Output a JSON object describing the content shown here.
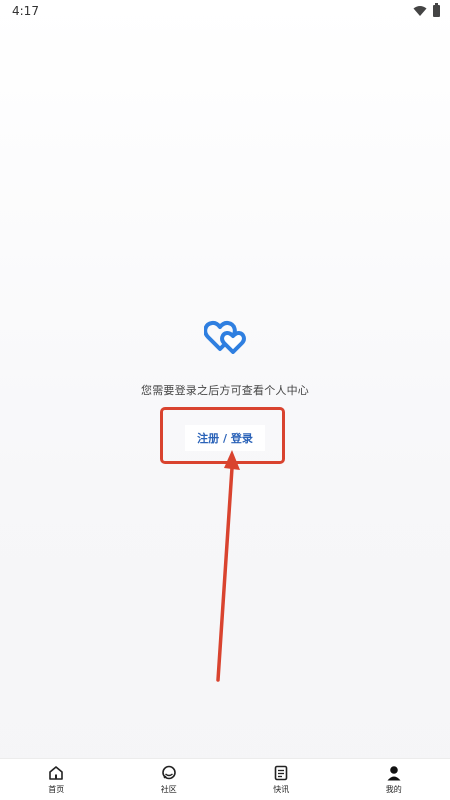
{
  "status_bar": {
    "time": "4:17",
    "icons": [
      "wifi-icon",
      "battery-icon"
    ]
  },
  "main": {
    "logo_icon": "heart-icon",
    "hint_text": "您需要登录之后方可查看个人中心",
    "login_button_label": "注册 / 登录"
  },
  "bottom_nav": {
    "items": [
      {
        "label": "首页",
        "icon": "home-icon"
      },
      {
        "label": "社区",
        "icon": "community-icon"
      },
      {
        "label": "快讯",
        "icon": "news-icon"
      },
      {
        "label": "我的",
        "icon": "profile-icon",
        "active": true
      }
    ]
  },
  "colors": {
    "accent": "#2b63b8",
    "heart": "#2f7fe0",
    "annotation": "#d9432f"
  }
}
